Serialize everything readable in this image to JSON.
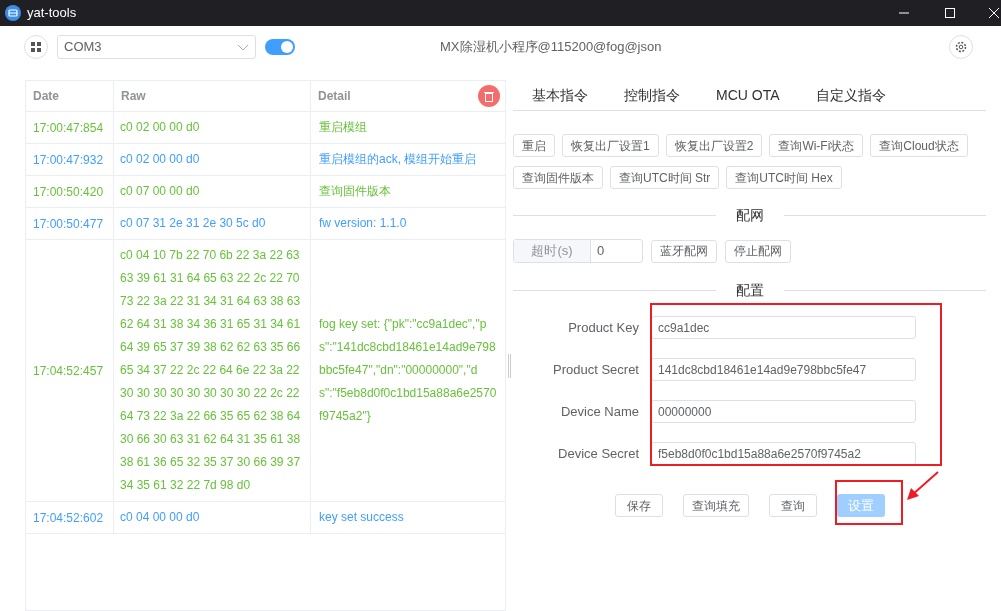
{
  "window": {
    "title": "yat-tools"
  },
  "toolbar": {
    "port": "COM3",
    "connected": true,
    "title": "MX除湿机小程序@115200@fog@json"
  },
  "log": {
    "columns": [
      "Date",
      "Raw",
      "Detail"
    ],
    "rows": [
      {
        "kind": "tx",
        "date": "17:00:47:854",
        "raw": "c0 02 00 00 d0",
        "detail": "重启模组"
      },
      {
        "kind": "rx",
        "date": "17:00:47:932",
        "raw": "c0 02 00 00 d0",
        "detail": "重启模组的ack, 模组开始重启"
      },
      {
        "kind": "tx",
        "date": "17:00:50:420",
        "raw": "c0 07 00 00 d0",
        "detail": "查询固件版本"
      },
      {
        "kind": "rx",
        "date": "17:00:50:477",
        "raw": "c0 07 31 2e 31 2e 30 5c d0",
        "detail": "fw version: 1.1.0"
      },
      {
        "kind": "tx",
        "date": "17:04:52:457",
        "raw": "c0 04 10 7b 22 70 6b 22 3a 22 63 63 39 61 31 64 65 63 22 2c 22 70 73 22 3a 22 31 34 31 64 63 38 63 62 64 31 38 34 36 31 65 31 34 61 64 39 65 37 39 38 62 62 63 35 66 65 34 37 22 2c 22 64 6e 22 3a 22 30 30 30 30 30 30 30 30 22 2c 22 64 73 22 3a 22 66 35 65 62 38 64 30 66 30 63 31 62 64 31 35 61 38 38 61 36 65 32 35 37 30 66 39 37 34 35 61 32 22 7d 98 d0",
        "detail": "fog key set: {\"pk\":\"cc9a1dec\",\"ps\":\"141dc8cbd18461e14ad9e798bbc5fe47\",\"dn\":\"00000000\",\"ds\":\"f5eb8d0f0c1bd15a88a6e2570f9745a2\"}"
      },
      {
        "kind": "rx",
        "date": "17:04:52:602",
        "raw": "c0 04 00 00 d0",
        "detail": "key set success"
      }
    ]
  },
  "tabs": [
    {
      "label": "基本指令",
      "selected": false
    },
    {
      "label": "控制指令",
      "selected": false
    },
    {
      "label": "MCU OTA",
      "selected": false
    },
    {
      "label": "自定义指令",
      "selected": false
    }
  ],
  "commands": [
    "重启",
    "恢复出厂设置1",
    "恢复出厂设置2",
    "查询Wi-Fi状态",
    "查询Cloud状态",
    "查询固件版本",
    "查询UTC时间 Str",
    "查询UTC时间 Hex"
  ],
  "pairing": {
    "heading": "配网",
    "timeout_label": "超时(s)",
    "timeout_value": "0",
    "buttons": [
      "蓝牙配网",
      "停止配网"
    ]
  },
  "config": {
    "heading": "配置",
    "fields": [
      {
        "label": "Product Key",
        "value": "cc9a1dec"
      },
      {
        "label": "Product Secret",
        "value": "141dc8cbd18461e14ad9e798bbc5fe47"
      },
      {
        "label": "Device Name",
        "value": "00000000"
      },
      {
        "label": "Device Secret",
        "value": "f5eb8d0f0c1bd15a88a6e2570f9745a2"
      }
    ],
    "actions": [
      {
        "label": "保存",
        "kind": "default"
      },
      {
        "label": "查询填充",
        "kind": "default"
      },
      {
        "label": "查询",
        "kind": "default"
      },
      {
        "label": "设置",
        "kind": "primary"
      }
    ]
  }
}
